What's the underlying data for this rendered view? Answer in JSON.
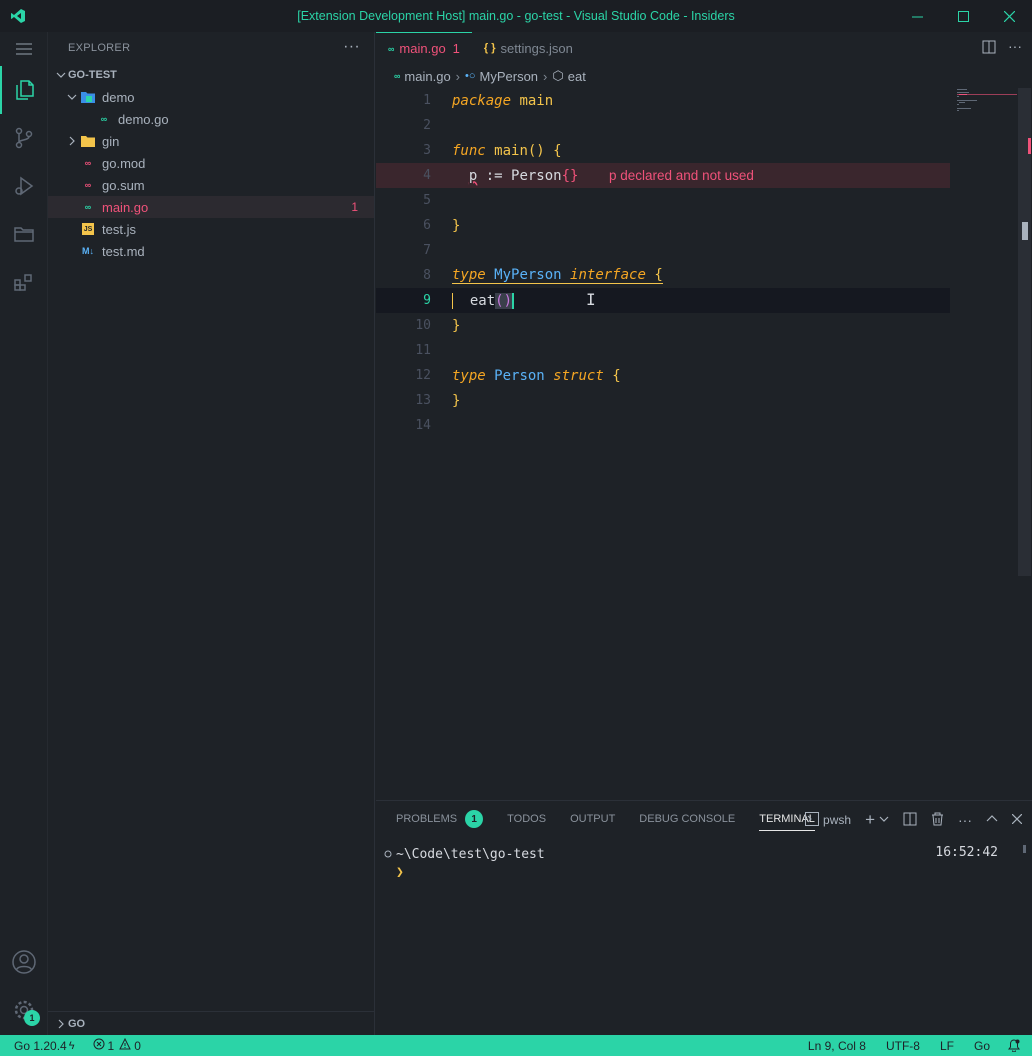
{
  "window": {
    "title": "[Extension Development Host] main.go - go-test - Visual Studio Code - Insiders"
  },
  "sidebar": {
    "header": "EXPLORER",
    "more": "···",
    "project": "GO-TEST",
    "tree": [
      {
        "label": "demo",
        "type": "folder-open",
        "depth": 1,
        "icon": "folder-open-icon"
      },
      {
        "label": "demo.go",
        "type": "go",
        "depth": 2,
        "icon": "go-file-icon"
      },
      {
        "label": "gin",
        "type": "folder",
        "depth": 1,
        "icon": "folder-icon"
      },
      {
        "label": "go.mod",
        "type": "gomod",
        "depth": 1,
        "icon": "go-mod-icon"
      },
      {
        "label": "go.sum",
        "type": "gomod",
        "depth": 1,
        "icon": "go-sum-icon"
      },
      {
        "label": "main.go",
        "type": "go",
        "depth": 1,
        "icon": "go-file-icon",
        "selected": true,
        "errors": "1"
      },
      {
        "label": "test.js",
        "type": "js",
        "depth": 1,
        "icon": "js-file-icon"
      },
      {
        "label": "test.md",
        "type": "md",
        "depth": 1,
        "icon": "markdown-file-icon"
      }
    ],
    "go_section": "GO"
  },
  "activity": {
    "settings_badge": "1"
  },
  "tabs": [
    {
      "label": "main.go",
      "badge": "1",
      "icon": "go-file-icon",
      "active": true
    },
    {
      "label": "settings.json",
      "icon": "json-file-icon",
      "active": false
    }
  ],
  "breadcrumb": {
    "file": "main.go",
    "symbol": "MyPerson",
    "method": "eat"
  },
  "editor": {
    "line_numbers": [
      "1",
      "2",
      "3",
      "4",
      "5",
      "6",
      "7",
      "8",
      "9",
      "10",
      "11",
      "12",
      "13",
      "14"
    ],
    "current_line": "9",
    "error_message": "p declared and not used"
  },
  "panel": {
    "tabs": [
      "PROBLEMS",
      "TODOS",
      "OUTPUT",
      "DEBUG CONSOLE",
      "TERMINAL"
    ],
    "problems_count": "1",
    "shell": "pwsh",
    "terminal": {
      "cwd": "~\\Code\\test\\go-test",
      "prompt": "❯",
      "time": "16:52:42"
    }
  },
  "statusbar": {
    "go_version": "Go 1.20.4",
    "errors": "1",
    "warnings": "0",
    "position": "Ln 9, Col 8",
    "encoding": "UTF-8",
    "eol": "LF",
    "language": "Go"
  },
  "colors": {
    "accent": "#2bd4a7",
    "error": "#f0527a",
    "keyword": "#f5a623",
    "type": "#5ab2f7"
  }
}
